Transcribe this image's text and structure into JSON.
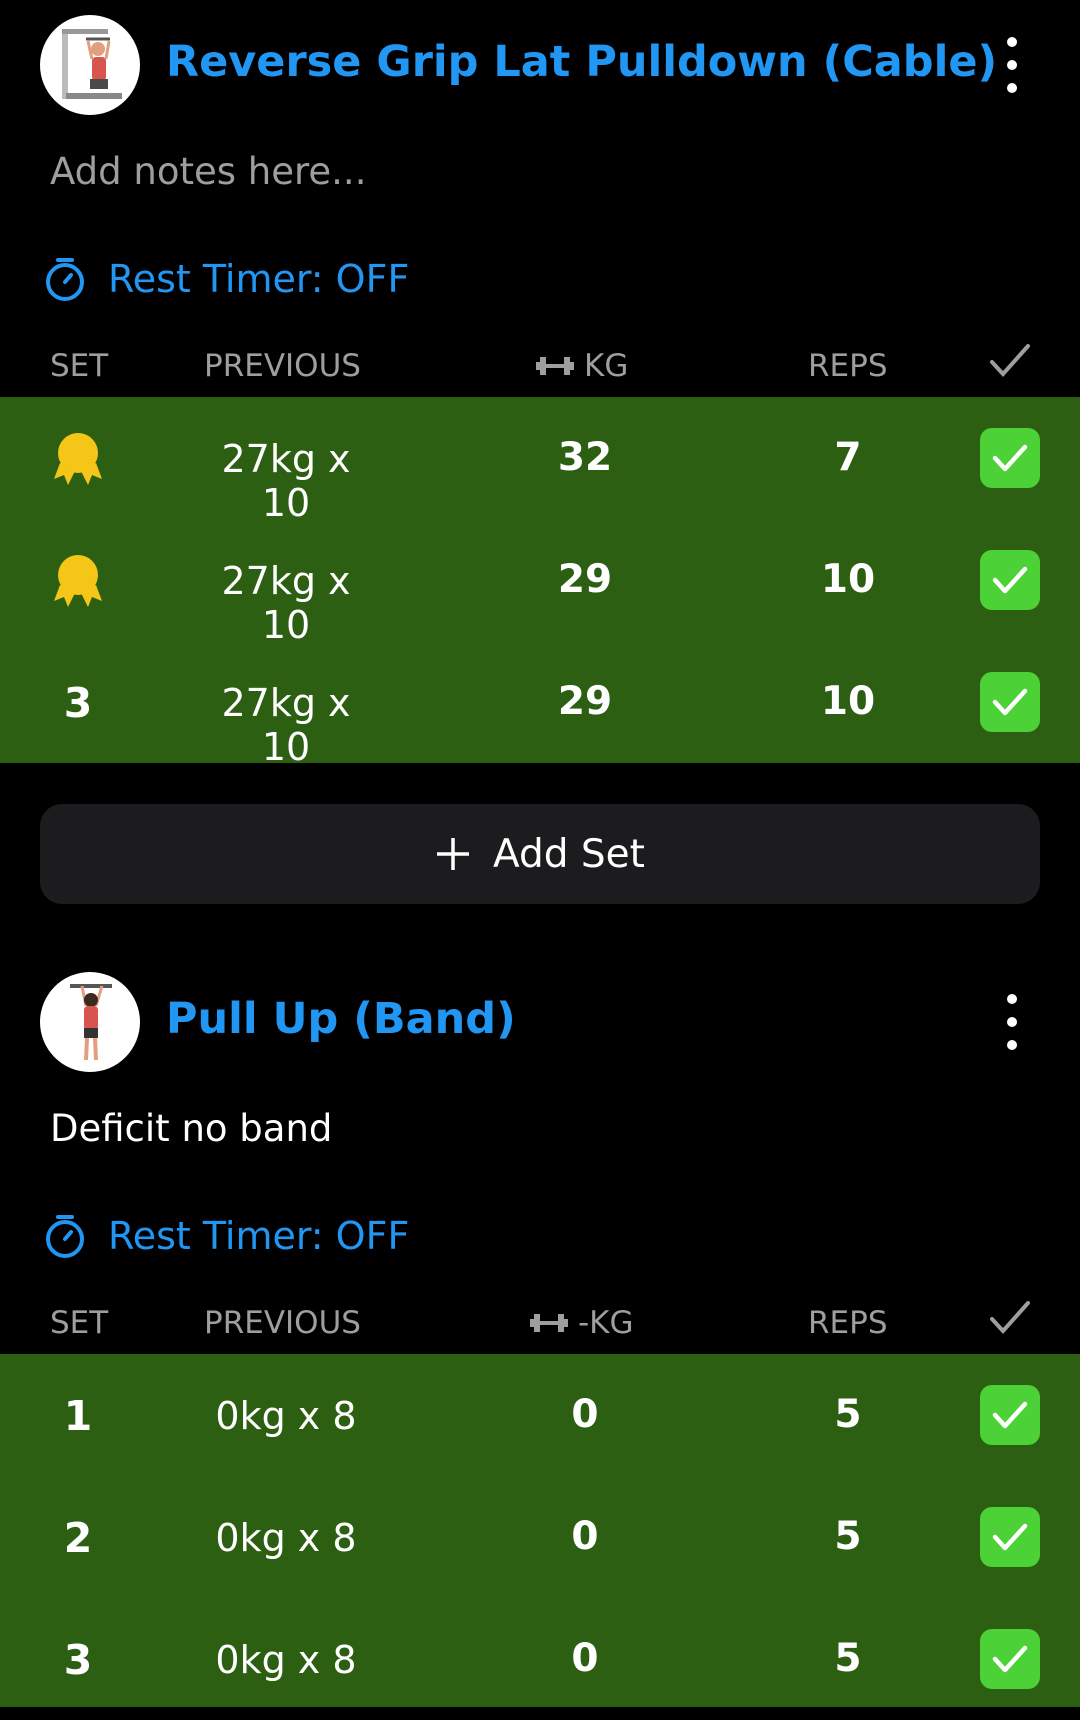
{
  "exercises": [
    {
      "title": "Reverse Grip Lat Pulldown (Cable)",
      "notes_placeholder": "Add notes here...",
      "rest_timer": "Rest Timer: OFF",
      "columns": {
        "set": "SET",
        "previous": "PREVIOUS",
        "weight": "KG",
        "reps": "REPS"
      },
      "sets": [
        {
          "set": "",
          "badge": "medal-icon",
          "previous": "27kg x 10",
          "weight": "32",
          "reps": "7",
          "completed": true
        },
        {
          "set": "",
          "badge": "medal-icon",
          "previous": "27kg x 10",
          "weight": "29",
          "reps": "10",
          "completed": true
        },
        {
          "set": "3",
          "previous": "27kg x 10",
          "weight": "29",
          "reps": "10",
          "completed": true
        }
      ],
      "add_set": "Add Set"
    },
    {
      "title": "Pull Up (Band)",
      "notes": "Deficit no band",
      "rest_timer": "Rest Timer: OFF",
      "columns": {
        "set": "SET",
        "previous": "PREVIOUS",
        "weight": "-KG",
        "reps": "REPS"
      },
      "sets": [
        {
          "set": "1",
          "previous": "0kg x 8",
          "weight": "0",
          "reps": "5",
          "completed": true
        },
        {
          "set": "2",
          "previous": "0kg x 8",
          "weight": "0",
          "reps": "5",
          "completed": true
        },
        {
          "set": "3",
          "previous": "0kg x 8",
          "weight": "0",
          "reps": "5",
          "completed": true
        }
      ]
    }
  ],
  "colors": {
    "accent": "#2196f3",
    "completed_row": "#2d5f13",
    "check_box": "#4cd137",
    "medal": "#f5c518",
    "background": "#000000"
  }
}
